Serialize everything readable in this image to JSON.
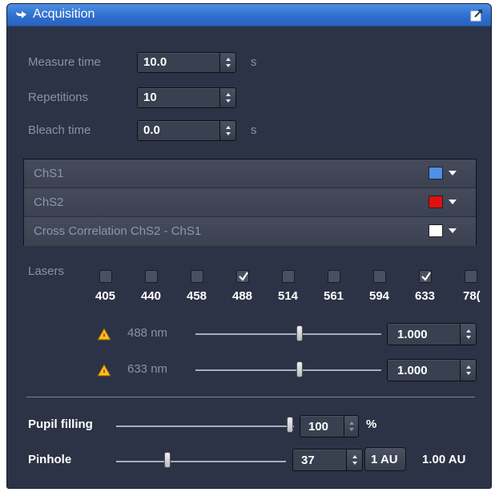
{
  "panel": {
    "title": "Acquisition",
    "title_icon": "collapse-arrow-icon",
    "pin_icon": "undock-icon",
    "header_color": "#3a7bd5"
  },
  "measure_time": {
    "label": "Measure time",
    "value": "10.0",
    "unit": "s"
  },
  "repetitions": {
    "label": "Repetitions",
    "value": "10"
  },
  "bleach_time": {
    "label": "Bleach time",
    "value": "0.0",
    "unit": "s"
  },
  "channels": [
    {
      "name": "ChS1",
      "color": "#4f8fe8"
    },
    {
      "name": "ChS2",
      "color": "#e01010"
    },
    {
      "name": "Cross Correlation ChS2 - ChS1",
      "color": "#ffffff"
    }
  ],
  "lasers": {
    "label": "Lasers",
    "lines": [
      {
        "wavelength": "405",
        "checked": false
      },
      {
        "wavelength": "440",
        "checked": false
      },
      {
        "wavelength": "458",
        "checked": false
      },
      {
        "wavelength": "488",
        "checked": true
      },
      {
        "wavelength": "514",
        "checked": false
      },
      {
        "wavelength": "561",
        "checked": false
      },
      {
        "wavelength": "594",
        "checked": false
      },
      {
        "wavelength": "633",
        "checked": true
      },
      {
        "wavelength": "78(",
        "checked": false
      }
    ],
    "power": [
      {
        "label": "488 nm",
        "value": "1.000"
      },
      {
        "label": "633 nm",
        "value": "1.000"
      }
    ]
  },
  "pupil_filling": {
    "label": "Pupil filling",
    "value": "100",
    "unit": "%"
  },
  "pinhole": {
    "label": "Pinhole",
    "value": "37",
    "button_label": "1 AU",
    "au_value": "1.00 AU"
  }
}
